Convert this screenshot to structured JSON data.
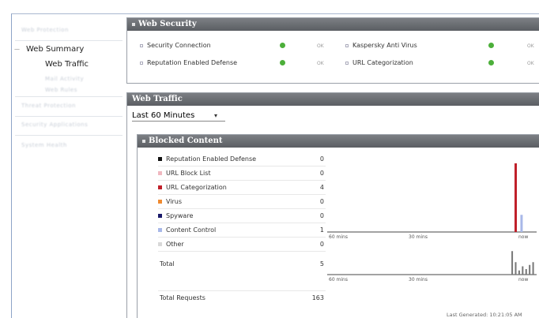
{
  "sidebar": {
    "blurred_top": "Web Protection",
    "web_summary": "Web Summary",
    "web_traffic": "Web Traffic",
    "sub_items": [
      "Mail Activity",
      "Web Rules"
    ],
    "blurred_items": [
      "Threat Protection",
      "Security Applications",
      "System Health"
    ]
  },
  "web_security": {
    "title": "Web Security",
    "rows": [
      {
        "label": "Security Connection",
        "status": "OK"
      },
      {
        "label": "Reputation Enabled Defense",
        "status": "OK"
      },
      {
        "label": "Kaspersky Anti Virus",
        "status": "OK"
      },
      {
        "label": "URL Categorization",
        "status": "OK"
      }
    ]
  },
  "web_traffic": {
    "title": "Web Traffic",
    "range": "Last 60 Minutes"
  },
  "blocked_content": {
    "title": "Blocked Content",
    "items": [
      {
        "label": "Reputation Enabled Defense",
        "value": "0",
        "color": "#111111"
      },
      {
        "label": "URL Block List",
        "value": "0",
        "color": "#f0b8c0"
      },
      {
        "label": "URL Categorization",
        "value": "4",
        "color": "#c0202a"
      },
      {
        "label": "Virus",
        "value": "0",
        "color": "#f08a30"
      },
      {
        "label": "Spyware",
        "value": "0",
        "color": "#1a1a6a"
      },
      {
        "label": "Content Control",
        "value": "1",
        "color": "#a8b8e8"
      },
      {
        "label": "Other",
        "value": "0",
        "color": "#d8d8d8"
      }
    ],
    "total_label": "Total",
    "total_value": "5",
    "requests_label": "Total Requests",
    "requests_value": "163",
    "last_generated": "Last Generated: 10:21:05 AM"
  },
  "chart_data": [
    {
      "type": "bar",
      "x_tick_labels": [
        "60 mins",
        "30 mins",
        "now"
      ],
      "series": [
        {
          "values": [
            {
              "x": 6,
              "y": 4
            }
          ],
          "color": "#c0202a"
        },
        {
          "values": [
            {
              "x": 5,
              "y": 1
            }
          ],
          "color": "#a8b8e8"
        }
      ],
      "ylim": [
        0,
        4
      ]
    },
    {
      "type": "line",
      "x_tick_labels": [
        "60 mins",
        "30 mins",
        "now"
      ],
      "series": [
        {
          "values": [
            {
              "x": 7,
              "y": 17
            },
            {
              "x": 6,
              "y": 9
            },
            {
              "x": 5,
              "y": 3
            },
            {
              "x": 4,
              "y": 6
            },
            {
              "x": 3,
              "y": 4
            },
            {
              "x": 2,
              "y": 7
            },
            {
              "x": 1,
              "y": 9
            }
          ],
          "color": "#777777"
        }
      ],
      "ylim": [
        0,
        20
      ]
    }
  ]
}
